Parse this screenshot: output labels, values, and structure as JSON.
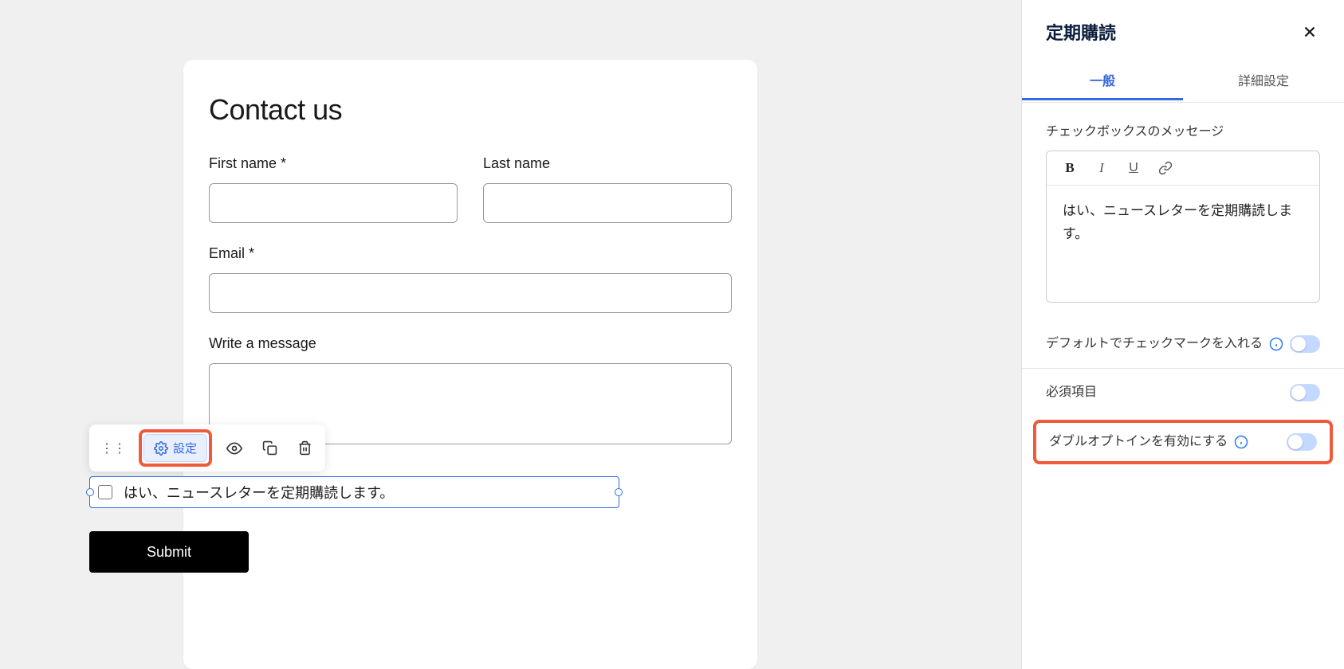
{
  "form": {
    "title": "Contact us",
    "first_name_label": "First name *",
    "last_name_label": "Last name",
    "email_label": "Email *",
    "message_label": "Write a message",
    "checkbox_text": "はい、ニュースレターを定期購読します。",
    "submit_label": "Submit"
  },
  "toolbar": {
    "settings_label": "設定"
  },
  "sidebar": {
    "title": "定期購読",
    "tabs": {
      "general": "一般",
      "advanced": "詳細設定"
    },
    "checkbox_message_label": "チェックボックスのメッセージ",
    "editor_content": "はい、ニュースレターを定期購読します。",
    "toggles": {
      "default_checked": "デフォルトでチェックマークを入れる",
      "required": "必須項目",
      "double_optin": "ダブルオプトインを有効にする"
    }
  }
}
